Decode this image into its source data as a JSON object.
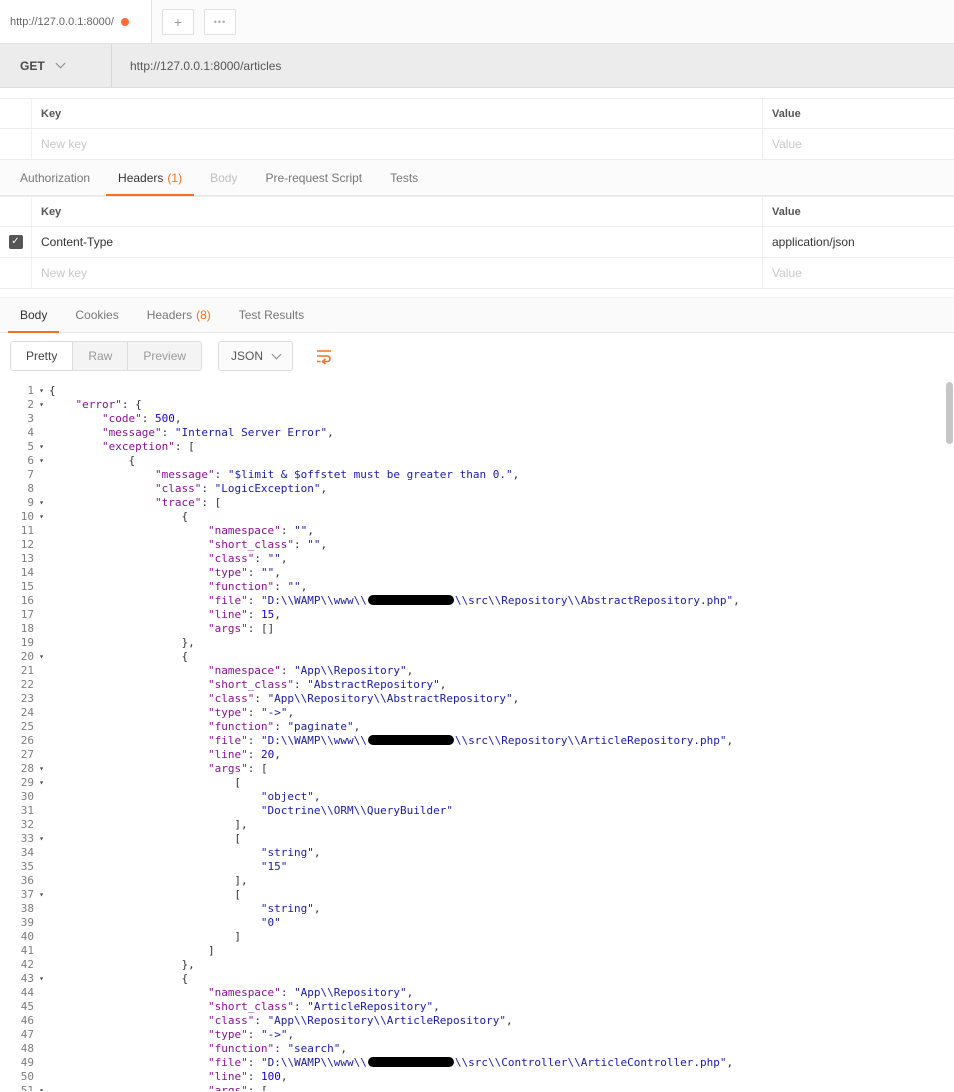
{
  "app": {
    "tab_title": "http://127.0.0.1:8000/",
    "new_tab_label": "+",
    "more_tabs_label": "•••"
  },
  "request": {
    "method": "GET",
    "url": "http://127.0.0.1:8000/articles"
  },
  "params_table": {
    "key_header": "Key",
    "value_header": "Value",
    "key_placeholder": "New key",
    "value_placeholder": "Value"
  },
  "request_tabs": {
    "items": [
      {
        "label": "Authorization"
      },
      {
        "label": "Headers",
        "count": "(1)"
      },
      {
        "label": "Body"
      },
      {
        "label": "Pre-request Script"
      },
      {
        "label": "Tests"
      }
    ]
  },
  "headers_table": {
    "key_header": "Key",
    "value_header": "Value",
    "rows": [
      {
        "key": "Content-Type",
        "value": "application/json",
        "checked": true
      }
    ],
    "key_placeholder": "New key",
    "value_placeholder": "Value"
  },
  "response_tabs": {
    "items": [
      {
        "label": "Body"
      },
      {
        "label": "Cookies"
      },
      {
        "label": "Headers",
        "count": "(8)"
      },
      {
        "label": "Test Results"
      }
    ]
  },
  "viewer": {
    "modes": [
      "Pretty",
      "Raw",
      "Preview"
    ],
    "active_mode": "Pretty",
    "language": "JSON"
  },
  "colors": {
    "accent": "#f47023",
    "unsaved_dot": "#ff6c37",
    "json_key": "#881391",
    "json_string": "#1a1aa8",
    "json_number": "#1c00cf"
  },
  "code": {
    "lines": [
      {
        "n": 1,
        "f": true,
        "s": [
          [
            "{",
            "p"
          ]
        ]
      },
      {
        "n": 2,
        "f": true,
        "s": [
          [
            "    ",
            "p"
          ],
          [
            "\"error\"",
            "k"
          ],
          [
            ": {",
            "p"
          ]
        ]
      },
      {
        "n": 3,
        "f": false,
        "s": [
          [
            "        ",
            "p"
          ],
          [
            "\"code\"",
            "k"
          ],
          [
            ": ",
            "p"
          ],
          [
            "500",
            "n"
          ],
          [
            ",",
            "p"
          ]
        ]
      },
      {
        "n": 4,
        "f": false,
        "s": [
          [
            "        ",
            "p"
          ],
          [
            "\"message\"",
            "k"
          ],
          [
            ": ",
            "p"
          ],
          [
            "\"Internal Server Error\"",
            "s"
          ],
          [
            ",",
            "p"
          ]
        ]
      },
      {
        "n": 5,
        "f": true,
        "s": [
          [
            "        ",
            "p"
          ],
          [
            "\"exception\"",
            "k"
          ],
          [
            ": [",
            "p"
          ]
        ]
      },
      {
        "n": 6,
        "f": true,
        "s": [
          [
            "            {",
            "p"
          ]
        ]
      },
      {
        "n": 7,
        "f": false,
        "s": [
          [
            "                ",
            "p"
          ],
          [
            "\"message\"",
            "k"
          ],
          [
            ": ",
            "p"
          ],
          [
            "\"$limit & $offstet must be greater than 0.\"",
            "s"
          ],
          [
            ",",
            "p"
          ]
        ]
      },
      {
        "n": 8,
        "f": false,
        "s": [
          [
            "                ",
            "p"
          ],
          [
            "\"class\"",
            "k"
          ],
          [
            ": ",
            "p"
          ],
          [
            "\"LogicException\"",
            "s"
          ],
          [
            ",",
            "p"
          ]
        ]
      },
      {
        "n": 9,
        "f": true,
        "s": [
          [
            "                ",
            "p"
          ],
          [
            "\"trace\"",
            "k"
          ],
          [
            ": [",
            "p"
          ]
        ]
      },
      {
        "n": 10,
        "f": true,
        "s": [
          [
            "                    {",
            "p"
          ]
        ]
      },
      {
        "n": 11,
        "f": false,
        "s": [
          [
            "                        ",
            "p"
          ],
          [
            "\"namespace\"",
            "k"
          ],
          [
            ": ",
            "p"
          ],
          [
            "\"\"",
            "s"
          ],
          [
            ",",
            "p"
          ]
        ]
      },
      {
        "n": 12,
        "f": false,
        "s": [
          [
            "                        ",
            "p"
          ],
          [
            "\"short_class\"",
            "k"
          ],
          [
            ": ",
            "p"
          ],
          [
            "\"\"",
            "s"
          ],
          [
            ",",
            "p"
          ]
        ]
      },
      {
        "n": 13,
        "f": false,
        "s": [
          [
            "                        ",
            "p"
          ],
          [
            "\"class\"",
            "k"
          ],
          [
            ": ",
            "p"
          ],
          [
            "\"\"",
            "s"
          ],
          [
            ",",
            "p"
          ]
        ]
      },
      {
        "n": 14,
        "f": false,
        "s": [
          [
            "                        ",
            "p"
          ],
          [
            "\"type\"",
            "k"
          ],
          [
            ": ",
            "p"
          ],
          [
            "\"\"",
            "s"
          ],
          [
            ",",
            "p"
          ]
        ]
      },
      {
        "n": 15,
        "f": false,
        "s": [
          [
            "                        ",
            "p"
          ],
          [
            "\"function\"",
            "k"
          ],
          [
            ": ",
            "p"
          ],
          [
            "\"\"",
            "s"
          ],
          [
            ",",
            "p"
          ]
        ]
      },
      {
        "n": 16,
        "f": false,
        "s": [
          [
            "                        ",
            "p"
          ],
          [
            "\"file\"",
            "k"
          ],
          [
            ": ",
            "p"
          ],
          [
            "\"D:\\\\WAMP\\\\www\\\\",
            "s"
          ],
          [
            "",
            "r"
          ],
          [
            "\\\\src\\\\Repository\\\\AbstractRepository.php\"",
            "s"
          ],
          [
            ",",
            "p"
          ]
        ]
      },
      {
        "n": 17,
        "f": false,
        "s": [
          [
            "                        ",
            "p"
          ],
          [
            "\"line\"",
            "k"
          ],
          [
            ": ",
            "p"
          ],
          [
            "15",
            "n"
          ],
          [
            ",",
            "p"
          ]
        ]
      },
      {
        "n": 18,
        "f": false,
        "s": [
          [
            "                        ",
            "p"
          ],
          [
            "\"args\"",
            "k"
          ],
          [
            ": []",
            "p"
          ]
        ]
      },
      {
        "n": 19,
        "f": false,
        "s": [
          [
            "                    },",
            "p"
          ]
        ]
      },
      {
        "n": 20,
        "f": true,
        "s": [
          [
            "                    {",
            "p"
          ]
        ]
      },
      {
        "n": 21,
        "f": false,
        "s": [
          [
            "                        ",
            "p"
          ],
          [
            "\"namespace\"",
            "k"
          ],
          [
            ": ",
            "p"
          ],
          [
            "\"App\\\\Repository\"",
            "s"
          ],
          [
            ",",
            "p"
          ]
        ]
      },
      {
        "n": 22,
        "f": false,
        "s": [
          [
            "                        ",
            "p"
          ],
          [
            "\"short_class\"",
            "k"
          ],
          [
            ": ",
            "p"
          ],
          [
            "\"AbstractRepository\"",
            "s"
          ],
          [
            ",",
            "p"
          ]
        ]
      },
      {
        "n": 23,
        "f": false,
        "s": [
          [
            "                        ",
            "p"
          ],
          [
            "\"class\"",
            "k"
          ],
          [
            ": ",
            "p"
          ],
          [
            "\"App\\\\Repository\\\\AbstractRepository\"",
            "s"
          ],
          [
            ",",
            "p"
          ]
        ]
      },
      {
        "n": 24,
        "f": false,
        "s": [
          [
            "                        ",
            "p"
          ],
          [
            "\"type\"",
            "k"
          ],
          [
            ": ",
            "p"
          ],
          [
            "\"->\"",
            "s"
          ],
          [
            ",",
            "p"
          ]
        ]
      },
      {
        "n": 25,
        "f": false,
        "s": [
          [
            "                        ",
            "p"
          ],
          [
            "\"function\"",
            "k"
          ],
          [
            ": ",
            "p"
          ],
          [
            "\"paginate\"",
            "s"
          ],
          [
            ",",
            "p"
          ]
        ]
      },
      {
        "n": 26,
        "f": false,
        "s": [
          [
            "                        ",
            "p"
          ],
          [
            "\"file\"",
            "k"
          ],
          [
            ": ",
            "p"
          ],
          [
            "\"D:\\\\WAMP\\\\www\\\\",
            "s"
          ],
          [
            "",
            "r"
          ],
          [
            "\\\\src\\\\Repository\\\\ArticleRepository.php\"",
            "s"
          ],
          [
            ",",
            "p"
          ]
        ]
      },
      {
        "n": 27,
        "f": false,
        "s": [
          [
            "                        ",
            "p"
          ],
          [
            "\"line\"",
            "k"
          ],
          [
            ": ",
            "p"
          ],
          [
            "20",
            "n"
          ],
          [
            ",",
            "p"
          ]
        ]
      },
      {
        "n": 28,
        "f": true,
        "s": [
          [
            "                        ",
            "p"
          ],
          [
            "\"args\"",
            "k"
          ],
          [
            ": [",
            "p"
          ]
        ]
      },
      {
        "n": 29,
        "f": true,
        "s": [
          [
            "                            [",
            "p"
          ]
        ]
      },
      {
        "n": 30,
        "f": false,
        "s": [
          [
            "                                ",
            "p"
          ],
          [
            "\"object\"",
            "s"
          ],
          [
            ",",
            "p"
          ]
        ]
      },
      {
        "n": 31,
        "f": false,
        "s": [
          [
            "                                ",
            "p"
          ],
          [
            "\"Doctrine\\\\ORM\\\\QueryBuilder\"",
            "s"
          ]
        ]
      },
      {
        "n": 32,
        "f": false,
        "s": [
          [
            "                            ],",
            "p"
          ]
        ]
      },
      {
        "n": 33,
        "f": true,
        "s": [
          [
            "                            [",
            "p"
          ]
        ]
      },
      {
        "n": 34,
        "f": false,
        "s": [
          [
            "                                ",
            "p"
          ],
          [
            "\"string\"",
            "s"
          ],
          [
            ",",
            "p"
          ]
        ]
      },
      {
        "n": 35,
        "f": false,
        "s": [
          [
            "                                ",
            "p"
          ],
          [
            "\"15\"",
            "s"
          ]
        ]
      },
      {
        "n": 36,
        "f": false,
        "s": [
          [
            "                            ],",
            "p"
          ]
        ]
      },
      {
        "n": 37,
        "f": true,
        "s": [
          [
            "                            [",
            "p"
          ]
        ]
      },
      {
        "n": 38,
        "f": false,
        "s": [
          [
            "                                ",
            "p"
          ],
          [
            "\"string\"",
            "s"
          ],
          [
            ",",
            "p"
          ]
        ]
      },
      {
        "n": 39,
        "f": false,
        "s": [
          [
            "                                ",
            "p"
          ],
          [
            "\"0\"",
            "s"
          ]
        ]
      },
      {
        "n": 40,
        "f": false,
        "s": [
          [
            "                            ]",
            "p"
          ]
        ]
      },
      {
        "n": 41,
        "f": false,
        "s": [
          [
            "                        ]",
            "p"
          ]
        ]
      },
      {
        "n": 42,
        "f": false,
        "s": [
          [
            "                    },",
            "p"
          ]
        ]
      },
      {
        "n": 43,
        "f": true,
        "s": [
          [
            "                    {",
            "p"
          ]
        ]
      },
      {
        "n": 44,
        "f": false,
        "s": [
          [
            "                        ",
            "p"
          ],
          [
            "\"namespace\"",
            "k"
          ],
          [
            ": ",
            "p"
          ],
          [
            "\"App\\\\Repository\"",
            "s"
          ],
          [
            ",",
            "p"
          ]
        ]
      },
      {
        "n": 45,
        "f": false,
        "s": [
          [
            "                        ",
            "p"
          ],
          [
            "\"short_class\"",
            "k"
          ],
          [
            ": ",
            "p"
          ],
          [
            "\"ArticleRepository\"",
            "s"
          ],
          [
            ",",
            "p"
          ]
        ]
      },
      {
        "n": 46,
        "f": false,
        "s": [
          [
            "                        ",
            "p"
          ],
          [
            "\"class\"",
            "k"
          ],
          [
            ": ",
            "p"
          ],
          [
            "\"App\\\\Repository\\\\ArticleRepository\"",
            "s"
          ],
          [
            ",",
            "p"
          ]
        ]
      },
      {
        "n": 47,
        "f": false,
        "s": [
          [
            "                        ",
            "p"
          ],
          [
            "\"type\"",
            "k"
          ],
          [
            ": ",
            "p"
          ],
          [
            "\"->\"",
            "s"
          ],
          [
            ",",
            "p"
          ]
        ]
      },
      {
        "n": 48,
        "f": false,
        "s": [
          [
            "                        ",
            "p"
          ],
          [
            "\"function\"",
            "k"
          ],
          [
            ": ",
            "p"
          ],
          [
            "\"search\"",
            "s"
          ],
          [
            ",",
            "p"
          ]
        ]
      },
      {
        "n": 49,
        "f": false,
        "s": [
          [
            "                        ",
            "p"
          ],
          [
            "\"file\"",
            "k"
          ],
          [
            ": ",
            "p"
          ],
          [
            "\"D:\\\\WAMP\\\\www\\\\",
            "s"
          ],
          [
            "",
            "r"
          ],
          [
            "\\\\src\\\\Controller\\\\ArticleController.php\"",
            "s"
          ],
          [
            ",",
            "p"
          ]
        ]
      },
      {
        "n": 50,
        "f": false,
        "s": [
          [
            "                        ",
            "p"
          ],
          [
            "\"line\"",
            "k"
          ],
          [
            ": ",
            "p"
          ],
          [
            "100",
            "n"
          ],
          [
            ",",
            "p"
          ]
        ]
      },
      {
        "n": 51,
        "f": true,
        "s": [
          [
            "                        ",
            "p"
          ],
          [
            "\"args\"",
            "k"
          ],
          [
            ": [",
            "p"
          ]
        ]
      }
    ]
  }
}
